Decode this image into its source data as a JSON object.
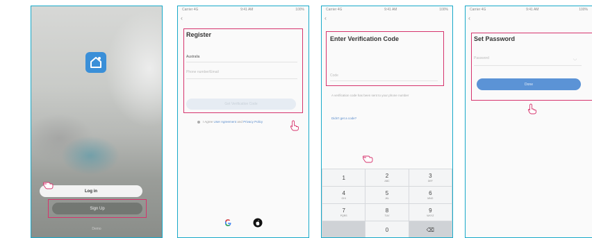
{
  "screen1": {
    "login_label": "Log in",
    "signup_label": "Sign Up",
    "footer_label": "Demo"
  },
  "screen2": {
    "status_left": "Carrier 4G",
    "status_center": "9:41 AM",
    "status_right": "100%",
    "title": "Register",
    "field1_label": "Australia",
    "field2_placeholder": "Phone number/Email",
    "cta_label": "Get Verification Code",
    "agree_text": "I Agree",
    "agree_link1": "User Agreement",
    "agree_and": "and",
    "agree_link2": "Privacy Policy"
  },
  "screen3": {
    "status_left": "Carrier 4G",
    "status_center": "9:41 AM",
    "status_right": "100%",
    "title": "Enter Verification Code",
    "code_placeholder": "Code",
    "hint": "A verification code has been sent to your phone number",
    "resend_label": "Didn't get a code?",
    "keys": [
      {
        "num": "1",
        "sub": ""
      },
      {
        "num": "2",
        "sub": "ABC"
      },
      {
        "num": "3",
        "sub": "DEF"
      },
      {
        "num": "4",
        "sub": "GHI"
      },
      {
        "num": "5",
        "sub": "JKL"
      },
      {
        "num": "6",
        "sub": "MNO"
      },
      {
        "num": "7",
        "sub": "PQRS"
      },
      {
        "num": "8",
        "sub": "TUV"
      },
      {
        "num": "9",
        "sub": "WXYZ"
      },
      {
        "num": "",
        "sub": ""
      },
      {
        "num": "0",
        "sub": ""
      },
      {
        "num": "⌫",
        "sub": ""
      }
    ]
  },
  "screen4": {
    "status_left": "Carrier 4G",
    "status_center": "9:41 AM",
    "status_right": "100%",
    "title": "Set Password",
    "password_placeholder": "Password",
    "done_label": "Done"
  },
  "colors": {
    "highlight": "#d6336c",
    "frame": "#17a9c9",
    "accent": "#5b93d6"
  }
}
